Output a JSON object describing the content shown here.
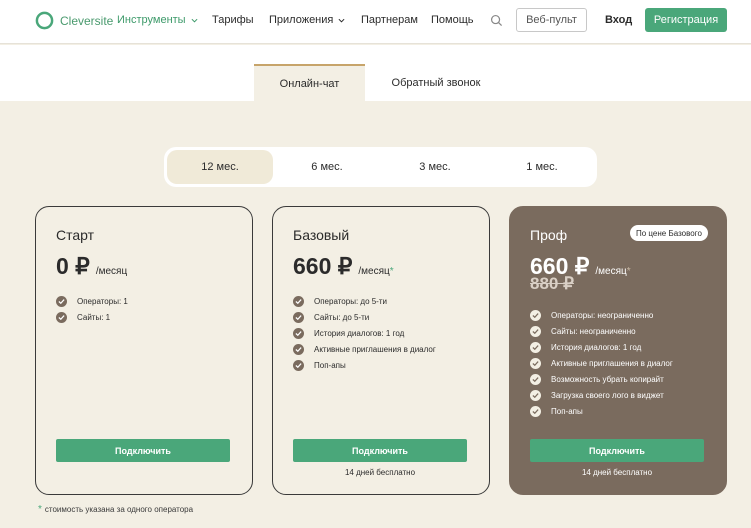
{
  "header": {
    "logo_text": "Cleversite",
    "nav": [
      {
        "label": "Инструменты",
        "active": true,
        "dropdown": true
      },
      {
        "label": "Тарифы"
      },
      {
        "label": "Приложения",
        "dropdown": true
      },
      {
        "label": "Партнерам"
      },
      {
        "label": "Помощь"
      }
    ],
    "web_panel_label": "Веб-пульт",
    "login_label": "Вход",
    "register_label": "Регистрация"
  },
  "product_tabs": [
    {
      "label": "Онлайн-чат",
      "active": true
    },
    {
      "label": "Обратный звонок",
      "active": false
    }
  ],
  "periods": [
    {
      "label": "12 мес.",
      "active": true
    },
    {
      "label": "6 мес."
    },
    {
      "label": "3 мес."
    },
    {
      "label": "1 мес."
    }
  ],
  "plans": [
    {
      "name": "Старт",
      "price": "0 ₽",
      "unit": "/месяц",
      "features": [
        "Операторы: 1",
        "Сайты: 1"
      ],
      "button": "Подключить"
    },
    {
      "name": "Базовый",
      "price": "660 ₽",
      "unit": "/месяц",
      "asterisk": "*",
      "features": [
        "Операторы: до 5-ти",
        "Сайты: до 5-ти",
        "История диалогов: 1 год",
        "Активные приглашения в диалог",
        "Поп-апы"
      ],
      "button": "Подключить",
      "trial": "14 дней бесплатно"
    },
    {
      "name": "Проф",
      "badge": "По цене Базового",
      "price": "660 ₽",
      "unit": "/месяц",
      "asterisk": "*",
      "old_price": "880 ₽",
      "features": [
        "Операторы: неограниченно",
        "Сайты: неограниченно",
        "История диалогов: 1 год",
        "Активные приглашения в диалог",
        "Возможность убрать копирайт",
        "Загрузка своего лого в виджет",
        "Поп-апы"
      ],
      "button": "Подключить",
      "trial": "14 дней бесплатно"
    }
  ],
  "footnote": {
    "asterisk": "*",
    "text": "стоимость указана за одного оператора"
  },
  "colors": {
    "accent": "#4aa77a",
    "dark_card": "#7a6b5e",
    "background": "#f3efe4",
    "tab_border": "#c7a46a"
  }
}
